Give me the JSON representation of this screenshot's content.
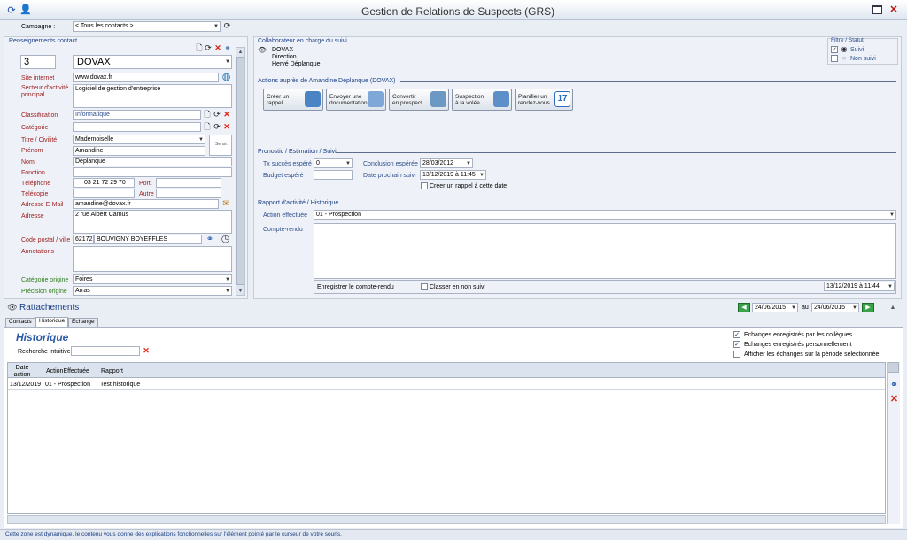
{
  "app": {
    "title": "Gestion de Relations de Suspects (GRS)"
  },
  "campagne": {
    "label": "Campagne :",
    "value": "< Tous les contacts >"
  },
  "contact": {
    "section": "Renseignements contact",
    "number": "3",
    "company": "DOVAX",
    "site_label": "Site internet",
    "site_value": "www.dovax.fr",
    "secteur_label": "Secteur d'activité principal",
    "secteur_value": "Logiciel de gestion d'entreprise",
    "classification_label": "Classification",
    "classification_value": "Informatique",
    "categorie_label": "Catégorie",
    "categorie_value": "",
    "titre_label": "Titre / Civilité",
    "titre_value": "Mademoiselle",
    "prenom_label": "Prénom",
    "prenom_value": "Amandine",
    "nom_label": "Nom",
    "nom_value": "Déplanque",
    "fonction_label": "Fonction",
    "fonction_value": "",
    "telephone_label": "Téléphone",
    "telephone_value": "03 21 72 29 70",
    "port_label": "Port.",
    "port_value": "",
    "telecopie_label": "Télécopie",
    "telecopie_value": "",
    "autre_label": "Autre",
    "autre_value": "",
    "email_label": "Adresse E-Mail",
    "email_value": "amandine@dovax.fr",
    "adresse_label": "Adresse",
    "adresse_value": "2 rue Albert Camus",
    "cp_label": "Code postal / ville",
    "cp_value": "62172",
    "ville_value": "BOUVIGNY BOYEFFLES",
    "annotations_label": "Annotations",
    "annotations_value": "",
    "cat_origine_label": "Catégorie origine",
    "cat_origine_value": "Foires",
    "precision_label": "Précision origine",
    "precision_value": "Arras",
    "sensi_label": "Sensi."
  },
  "collab": {
    "section": "Collaborateur en charge du suivi",
    "name": "DOVAX",
    "dept": "Direction",
    "person": "Hervé Déplanque"
  },
  "filtre": {
    "title": "Filtre / Statut",
    "suivi": "Suivi",
    "non_suivi": "Non suivi"
  },
  "actions": {
    "section": "Actions auprès de Amandine Déplanque (DOVAX)",
    "buttons": [
      {
        "line1": "Créer un",
        "line2": "rappel"
      },
      {
        "line1": "Envoyer une",
        "line2": "documentation"
      },
      {
        "line1": "Convertir",
        "line2": "en prospect"
      },
      {
        "line1": "Suspection",
        "line2": "à la volée"
      },
      {
        "line1": "Planifier un",
        "line2": "rendez-vous"
      }
    ],
    "calendar_day": "17"
  },
  "pronostic": {
    "section": "Pronostic / Estimation / Suivi",
    "tx_label": "Tx succès espéré",
    "tx_value": "0",
    "budget_label": "Budget espéré",
    "budget_value": "",
    "conclusion_label": "Conclusion espérée",
    "conclusion_value": "28/03/2012",
    "date_label": "Date prochain suivi",
    "date_value": "13/12/2019 à 11:45",
    "rappel_label": "Créer un rappel à cette date"
  },
  "rapport": {
    "section": "Rapport d'activité / Historique",
    "action_label": "Action effectuée",
    "action_value": "01 - Prospection",
    "compte_label": "Compte-rendu",
    "save_label": "Enregistrer le compte-rendu",
    "classer_label": "Classer en non suivi",
    "date_value": "13/12/2019 à 11:44"
  },
  "rattach": {
    "title": "Rattachements",
    "date_from": "24/06/2015",
    "au": "au",
    "date_to": "24/06/2015",
    "tabs": [
      "Contacts",
      "Historique",
      "Echange"
    ],
    "hist_title": "Historique",
    "recherche_label": "Recherche intuitive",
    "checks": [
      "Echanges enregistrés par les collègues",
      "Echanges enregistrés personnellement",
      "Afficher les échanges sur la période sélectionnée"
    ],
    "columns": [
      "Date action",
      "ActionEffectuée",
      "Rapport"
    ],
    "rows": [
      [
        "13/12/2019",
        "01 - Prospection",
        "Test historique"
      ]
    ]
  },
  "status": {
    "text": "Cette zone est dynamique, le contenu vous donne des explications fonctionnelles sur l'élément pointé par le curseur de votre souris."
  }
}
